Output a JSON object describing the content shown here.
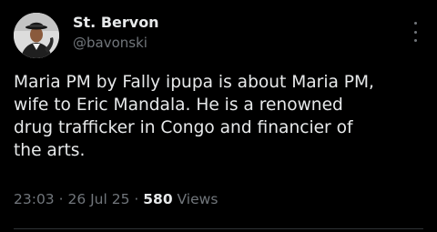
{
  "tweet": {
    "author": {
      "display_name": "St. Bervon",
      "handle": "@bavonski",
      "avatar_icon": "profile-photo-avatar"
    },
    "more_icon": "more-options-icon",
    "text_lines": [
      "Maria PM by Fally ipupa is about Maria PM,",
      "wife to Eric Mandala. He is a renowned",
      "drug trafficker in Congo and financier of",
      "the arts."
    ],
    "meta": {
      "time": "23:03",
      "separator": " · ",
      "date": "26 Jul 25",
      "views_count": "580",
      "views_label": " Views"
    }
  },
  "colors": {
    "background": "#000000",
    "primary_text": "#e7e9ea",
    "secondary_text": "#71767b",
    "divider": "#2f3336"
  }
}
